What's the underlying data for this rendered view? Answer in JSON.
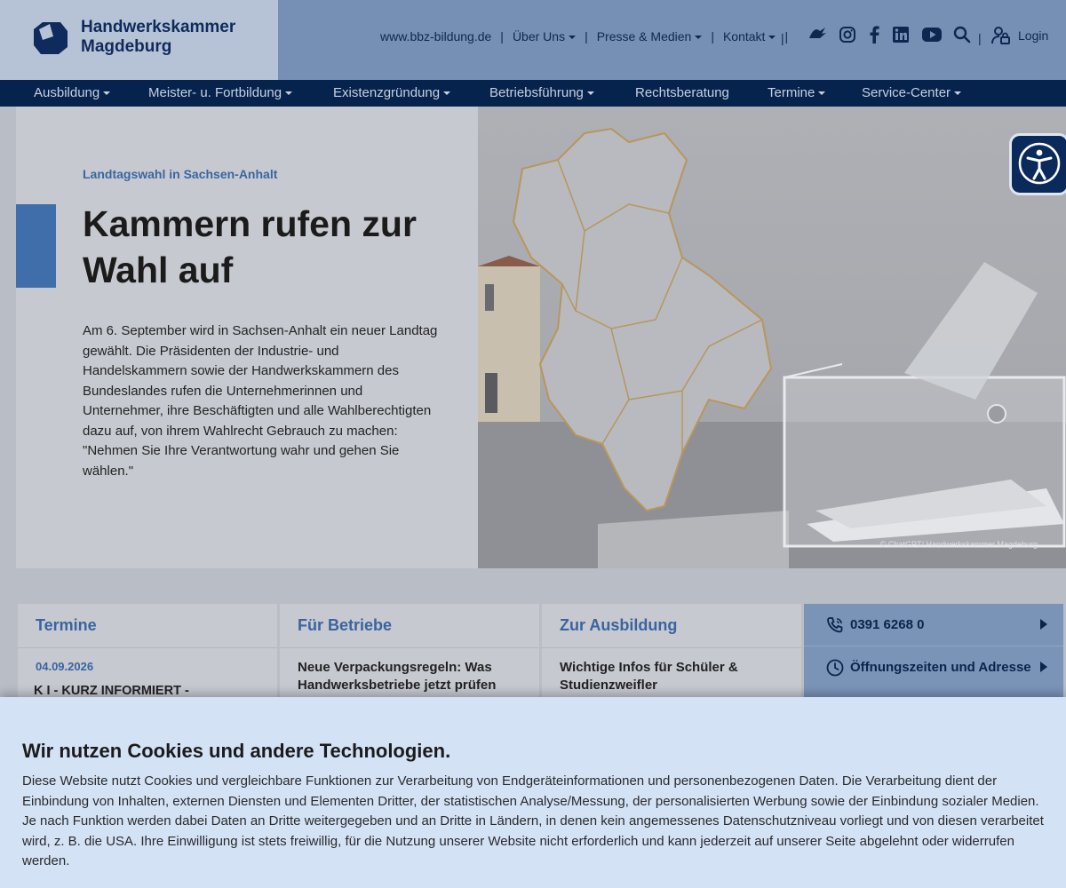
{
  "header": {
    "logo_line1": "Handwerkskammer",
    "logo_line2": "Magdeburg",
    "topnav": [
      {
        "label": "www.bbz-bildung.de",
        "dropdown": false
      },
      {
        "label": "Über Uns",
        "dropdown": true
      },
      {
        "label": "Presse & Medien",
        "dropdown": true
      },
      {
        "label": "Kontakt",
        "dropdown": true
      }
    ],
    "social_icons": [
      "sign-language-icon",
      "instagram-icon",
      "facebook-icon",
      "linkedin-icon",
      "youtube-icon",
      "search-icon"
    ],
    "login_label": "Login"
  },
  "mainnav": [
    {
      "label": "Ausbildung",
      "dropdown": true
    },
    {
      "label": "Meister- u. Fortbildung",
      "dropdown": true
    },
    {
      "label": "Existenzgründung",
      "dropdown": true
    },
    {
      "label": "Betriebsführung",
      "dropdown": true
    },
    {
      "label": "Rechtsberatung",
      "dropdown": false
    },
    {
      "label": "Termine",
      "dropdown": true
    },
    {
      "label": "Service-Center",
      "dropdown": true
    }
  ],
  "hero": {
    "kicker": "Landtagswahl in Sachsen-Anhalt",
    "title": "Kammern rufen zur Wahl auf",
    "body": "Am 6. September wird in Sachsen-Anhalt ein neuer Landtag gewählt. Die Präsidenten der Industrie- und Handelskammern sowie der Handwerkskammern des Bundeslandes rufen die Unternehmerinnen und Unternehmer, ihre Beschäftigten und alle Wahlberechtigten dazu auf, von ihrem Wahlrecht Gebrauch zu machen: \"Nehmen Sie Ihre Verantwortung wahr und gehen Sie wählen.\"",
    "image_credit": "© ChatGPT/ Handwerkskammer Magdeburg"
  },
  "cards": {
    "termine": {
      "title": "Termine",
      "date": "04.09.2026",
      "text": "K I - KURZ INFORMIERT - Generative"
    },
    "betriebe": {
      "title": "Für Betriebe",
      "text": "Neue Verpackungsregeln: Was Handwerksbetriebe jetzt prüfen"
    },
    "ausbildung": {
      "title": "Zur Ausbildung",
      "text": "Wichtige Infos für Schüler & Studienzweifler"
    }
  },
  "contact": {
    "phone": "0391 6268 0",
    "hours": "Öffnungszeiten und Adresse"
  },
  "cookie": {
    "title": "Wir nutzen Cookies und andere Technologien.",
    "text": "Diese Website nutzt Cookies und vergleichbare Funktionen zur Verarbeitung von Endgeräteinformationen und personenbezogenen Daten. Die Verarbeitung dient der Einbindung von Inhalten, externen Diensten und Elementen Dritter, der statistischen Analyse/Messung, der personalisierten Werbung sowie der Einbindung sozialer Medien. Je nach Funktion werden dabei Daten an Dritte weitergegeben und an Dritte in Ländern, in denen kein angemessenes Datenschutzniveau vorliegt und von diesen verarbeitet wird, z. B. die USA. Ihre Einwilligung ist stets freiwillig, für die Nutzung unserer Website nicht erforderlich und kann jederzeit auf unserer Seite abgelehnt oder widerrufen werden."
  },
  "colors": {
    "nav_bg": "#06234e",
    "accent_blue": "#3f6eaa",
    "header_bg": "#7590b4",
    "cookie_bg": "#d4e2f6"
  }
}
